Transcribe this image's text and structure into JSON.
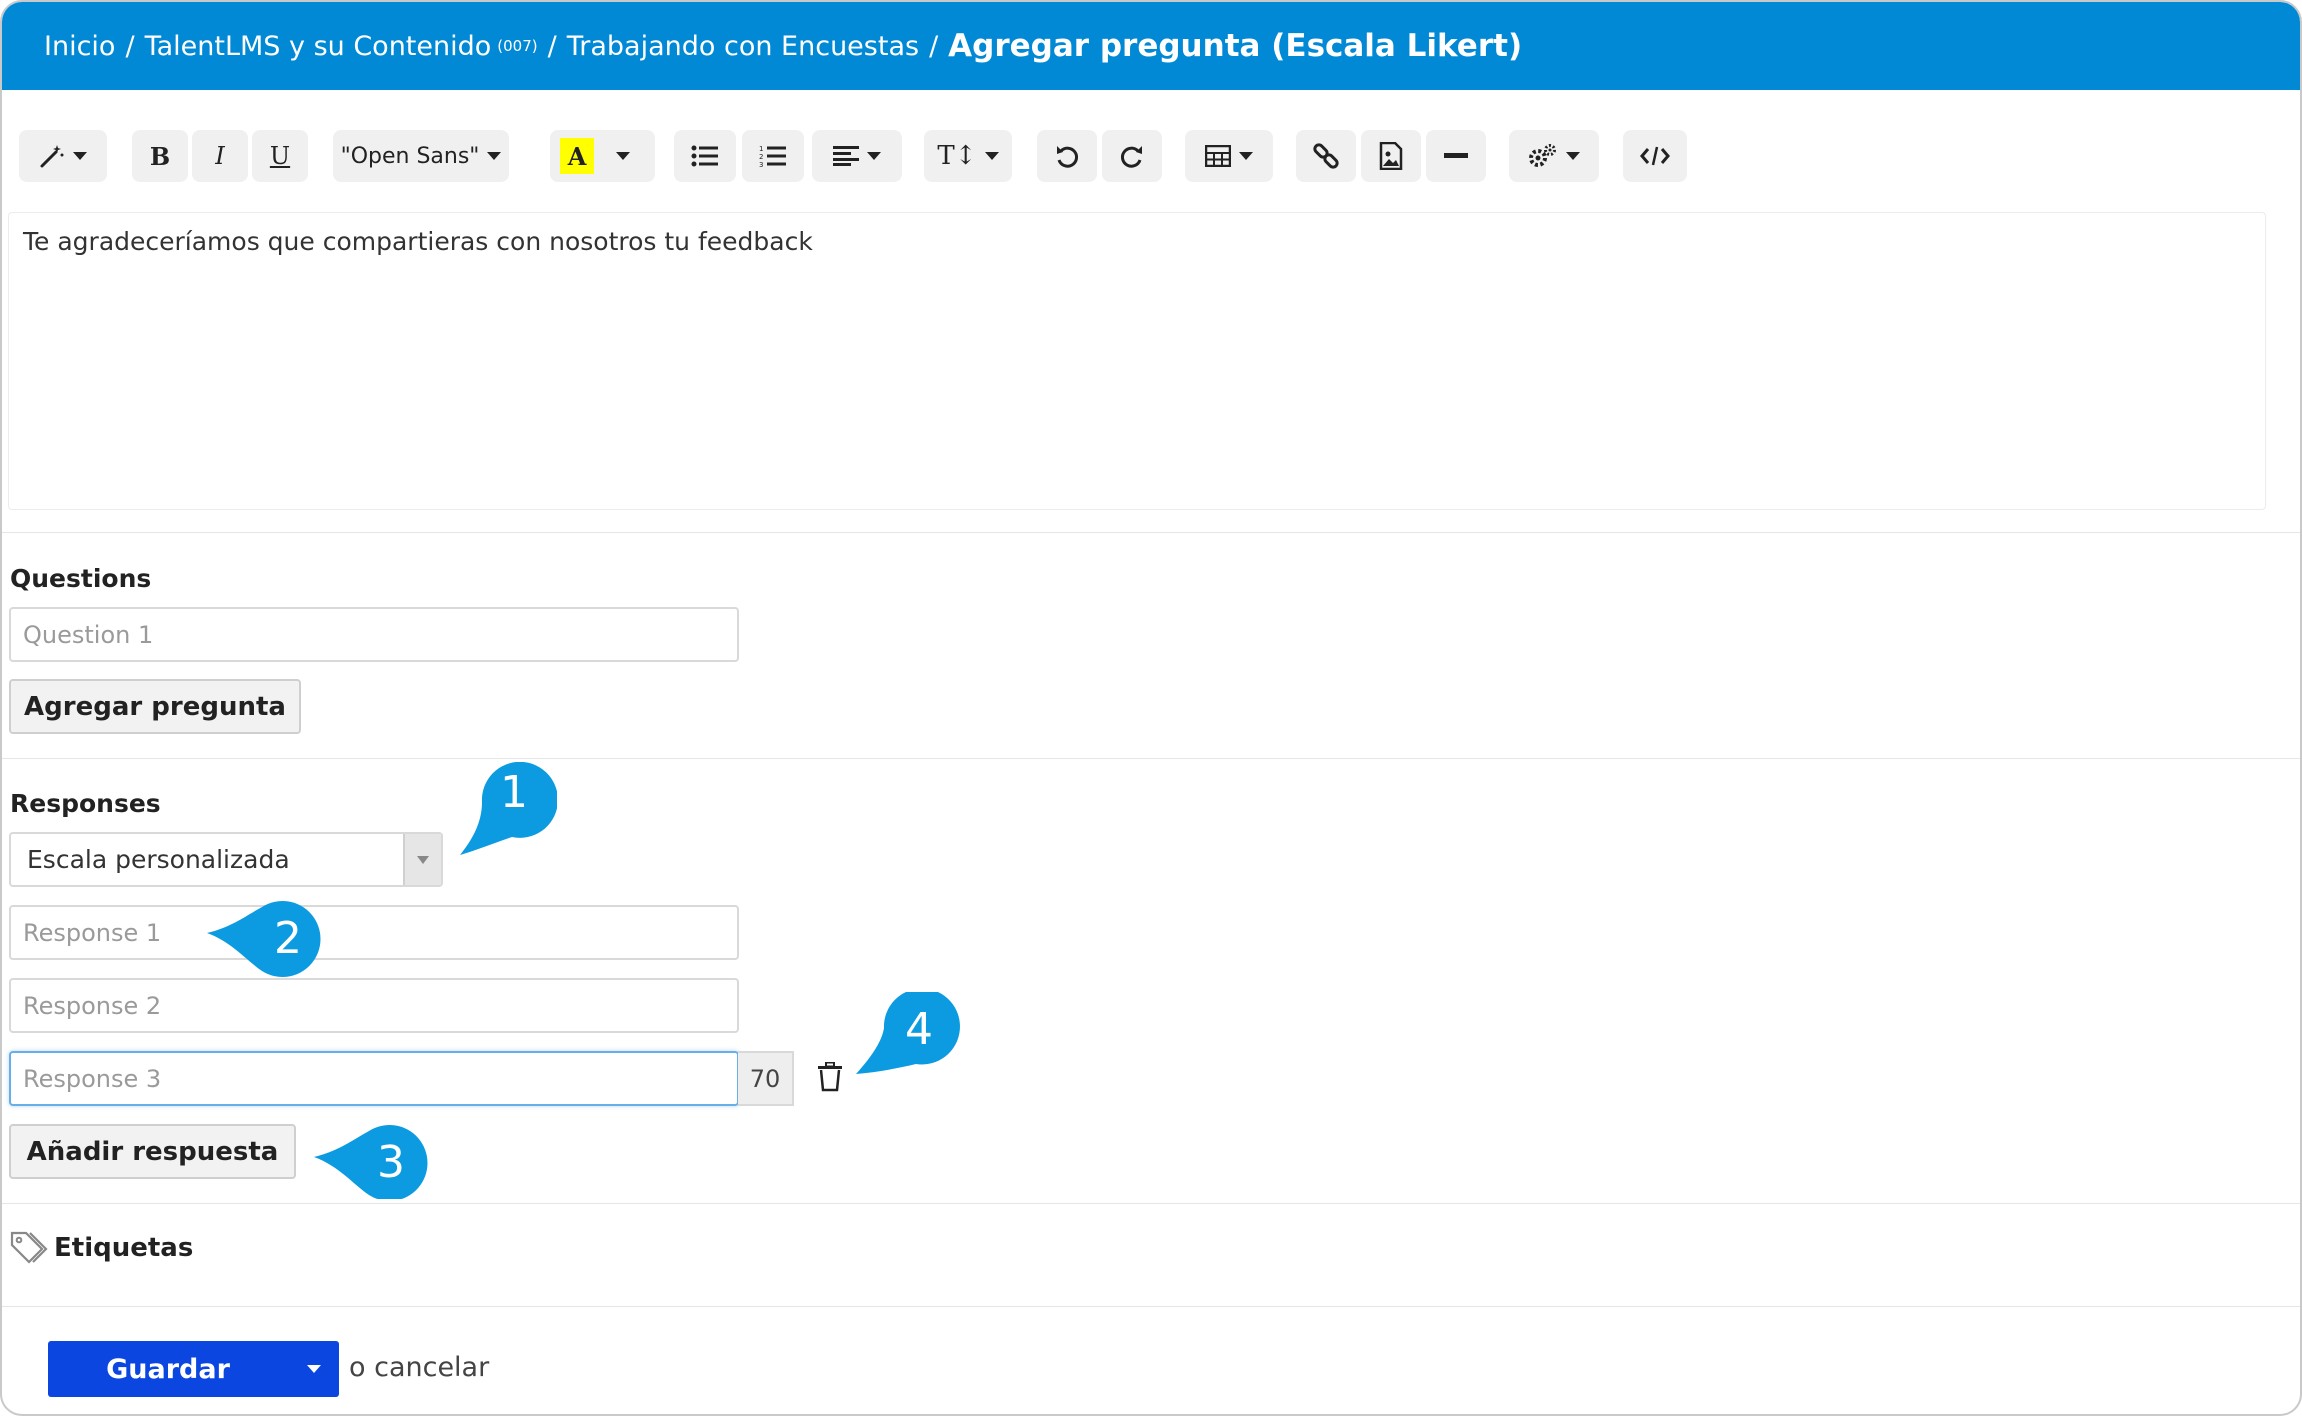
{
  "breadcrumb": {
    "home": "Inicio",
    "course": "TalentLMS y su Contenido",
    "course_code": "(007)",
    "unit": "Trabajando con Encuestas",
    "current": "Agregar pregunta (Escala Likert)",
    "separator": "/"
  },
  "toolbar": {
    "font_name": "\"Open Sans\"",
    "bold": "B",
    "italic": "I",
    "underline": "U",
    "highlight": "A",
    "text_size": "T↕",
    "highlight_color": "#ffff00"
  },
  "editor": {
    "content": "Te agradeceríamos que compartieras con nosotros tu feedback"
  },
  "questions": {
    "label": "Questions",
    "q1_placeholder": "Question 1",
    "add_button": "Agregar pregunta"
  },
  "responses": {
    "label": "Responses",
    "scale_type": "Escala personalizada",
    "r1_placeholder": "Response 1",
    "r2_placeholder": "Response 2",
    "r3_placeholder": "Response 3",
    "char_count": "70",
    "add_button": "Añadir respuesta"
  },
  "callouts": [
    "1",
    "2",
    "3",
    "4"
  ],
  "tags": {
    "label": "Etiquetas"
  },
  "footer": {
    "save": "Guardar",
    "cancel": "o cancelar"
  },
  "colors": {
    "header_bg": "#0289d6",
    "callout": "#0c9be0",
    "save_button": "#0b46e0"
  }
}
